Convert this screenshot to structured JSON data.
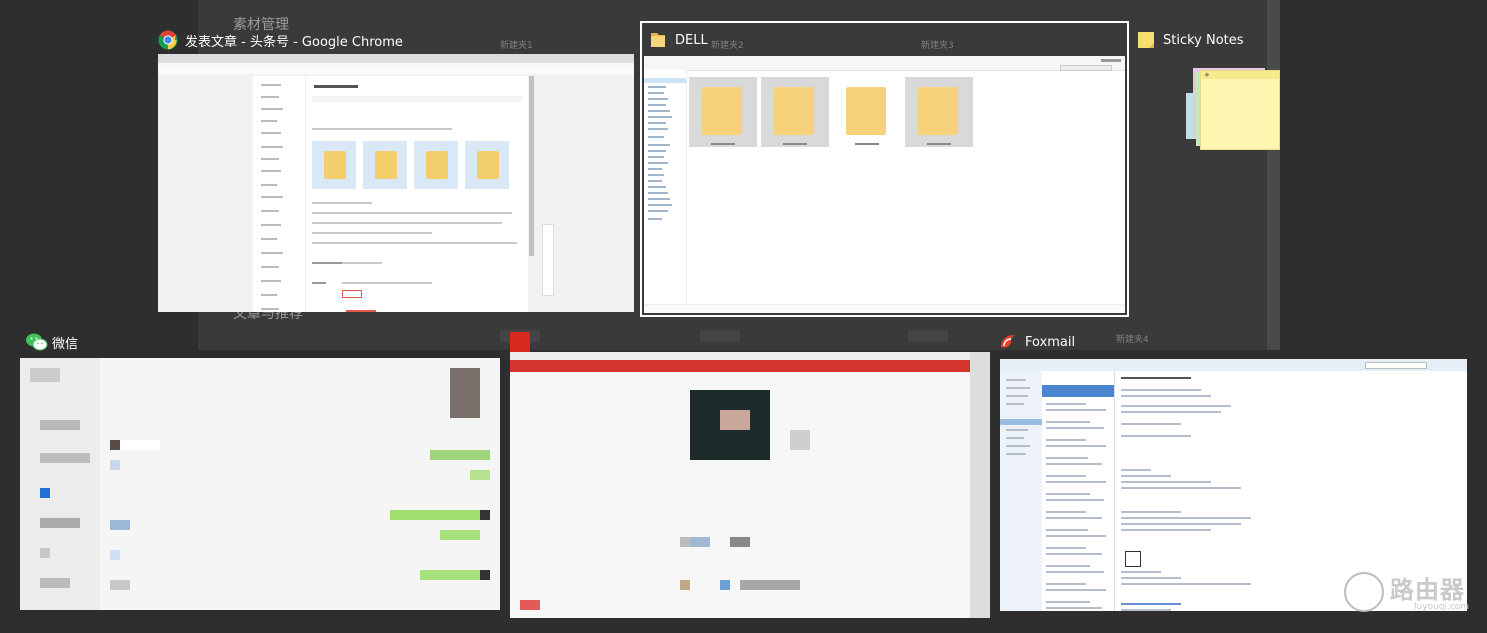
{
  "background": {
    "texts": [
      "素材管理",
      "文章与推荐"
    ],
    "folder_labels": [
      "新建夹1",
      "新建夹2",
      "新建夹3",
      "新建夹4"
    ]
  },
  "windows": {
    "chrome": {
      "title": "发表文章 - 头条号 - Google Chrome",
      "icon": "chrome-icon"
    },
    "explorer": {
      "title": "DELL",
      "icon": "folder-icon"
    },
    "sticky": {
      "title": "Sticky Notes",
      "icon": "sticky-notes-icon"
    },
    "wechat": {
      "title": "微信",
      "icon": "wechat-icon"
    },
    "browser2": {
      "title": "",
      "icon": "app-icon"
    },
    "foxmail": {
      "title": "Foxmail",
      "icon": "foxmail-icon"
    }
  },
  "watermark": {
    "text": "路由器",
    "sub": "luyouqi.com"
  },
  "colors": {
    "selection": "#ffffff",
    "folder": "#f5d27a",
    "wechat_green": "#07c160",
    "accent_red": "#d93b30"
  }
}
